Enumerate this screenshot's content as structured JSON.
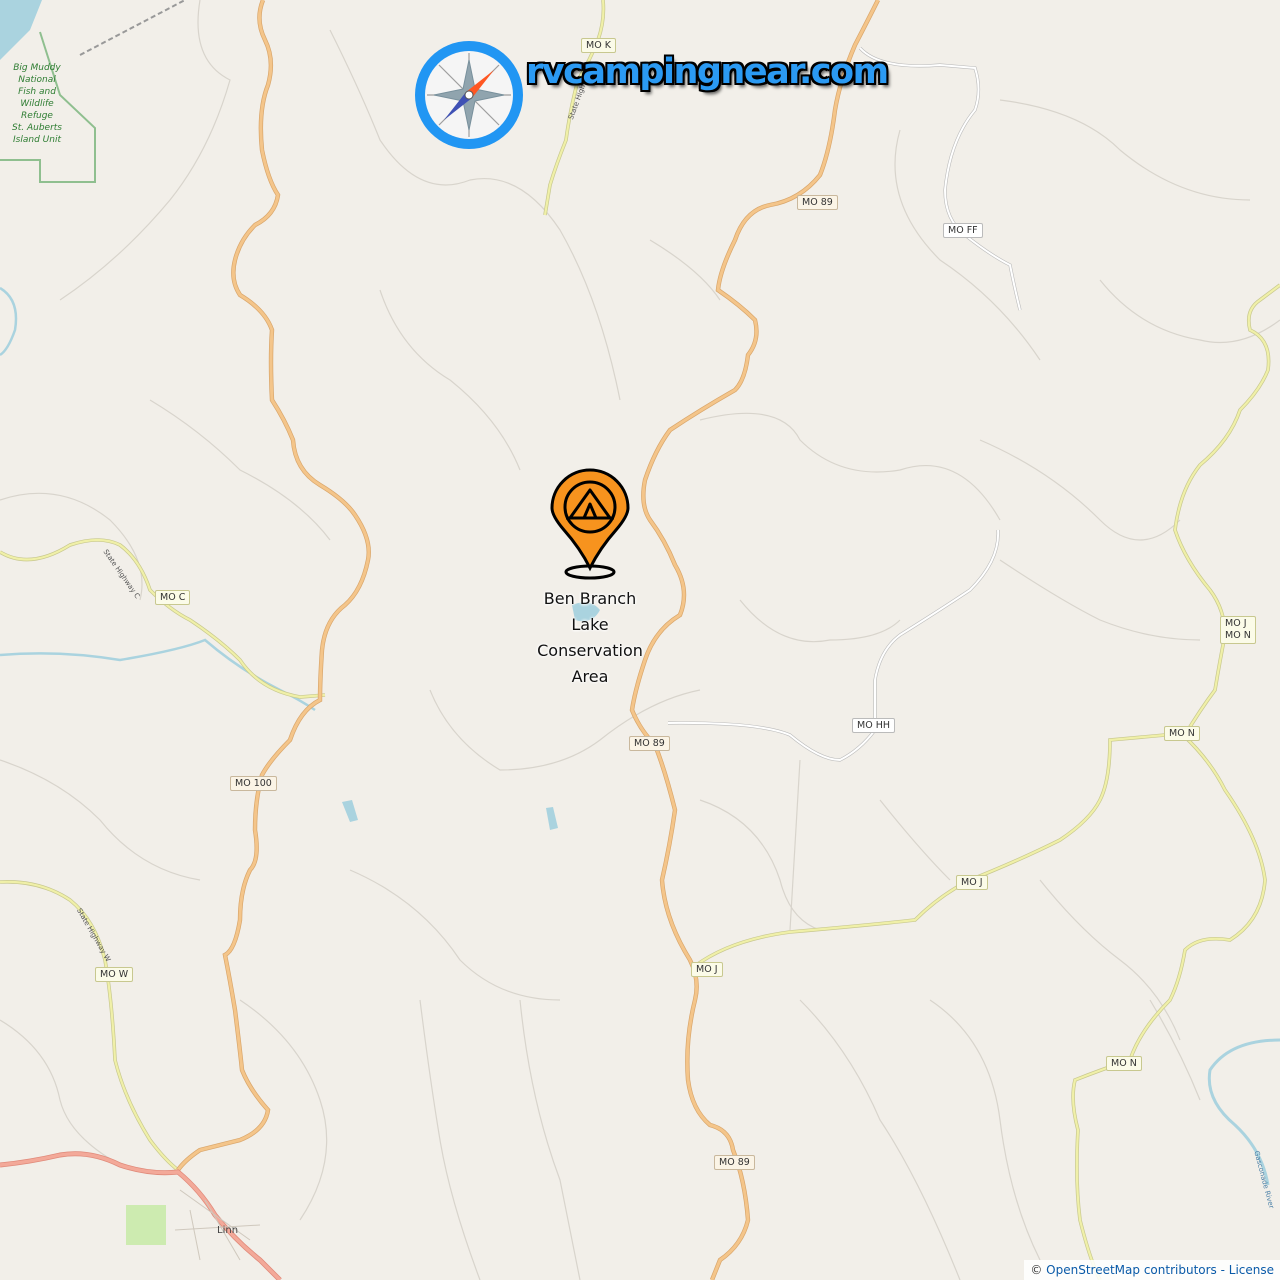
{
  "brand": {
    "text": "rvcampingnear.com",
    "icon": "compass-icon"
  },
  "poi": {
    "icon": "campsite-pin-icon",
    "label_lines": [
      "Ben Branch",
      "Lake",
      "Conservation",
      "Area"
    ]
  },
  "refuge_label": [
    "Big Muddy",
    "National",
    "Fish and",
    "Wildlife",
    "Refuge",
    "St. Auberts",
    "Island Unit"
  ],
  "town": "Linn",
  "shields": {
    "mo_k": "MO K",
    "mo_89_top": "MO 89",
    "mo_ff": "MO FF",
    "mo_c": "MO C",
    "mo_jn": "MO J",
    "mo_jn2": "MO N",
    "mo_hh": "MO HH",
    "mo_89_mid": "MO 89",
    "mo_n_right": "MO N",
    "mo_100": "MO 100",
    "mo_j_right": "MO J",
    "mo_w": "MO W",
    "mo_j_low": "MO J",
    "mo_n_low": "MO N",
    "mo_89_low": "MO 89"
  },
  "road_texts": {
    "state_hwy_c": "State Highway C",
    "state_hwy_w": "State Highway W",
    "state_hwy_k": "State Highway K",
    "gasconade": "Gasconade River"
  },
  "attribution": {
    "prefix": "© ",
    "link": "OpenStreetMap contributors",
    "suffix": " - License"
  },
  "colors": {
    "primary_road": "#f4c58a",
    "secondary_road": "#f0f0a8",
    "water": "#aad3df",
    "marker": "#f7931e",
    "brand": "#2b9af3"
  }
}
